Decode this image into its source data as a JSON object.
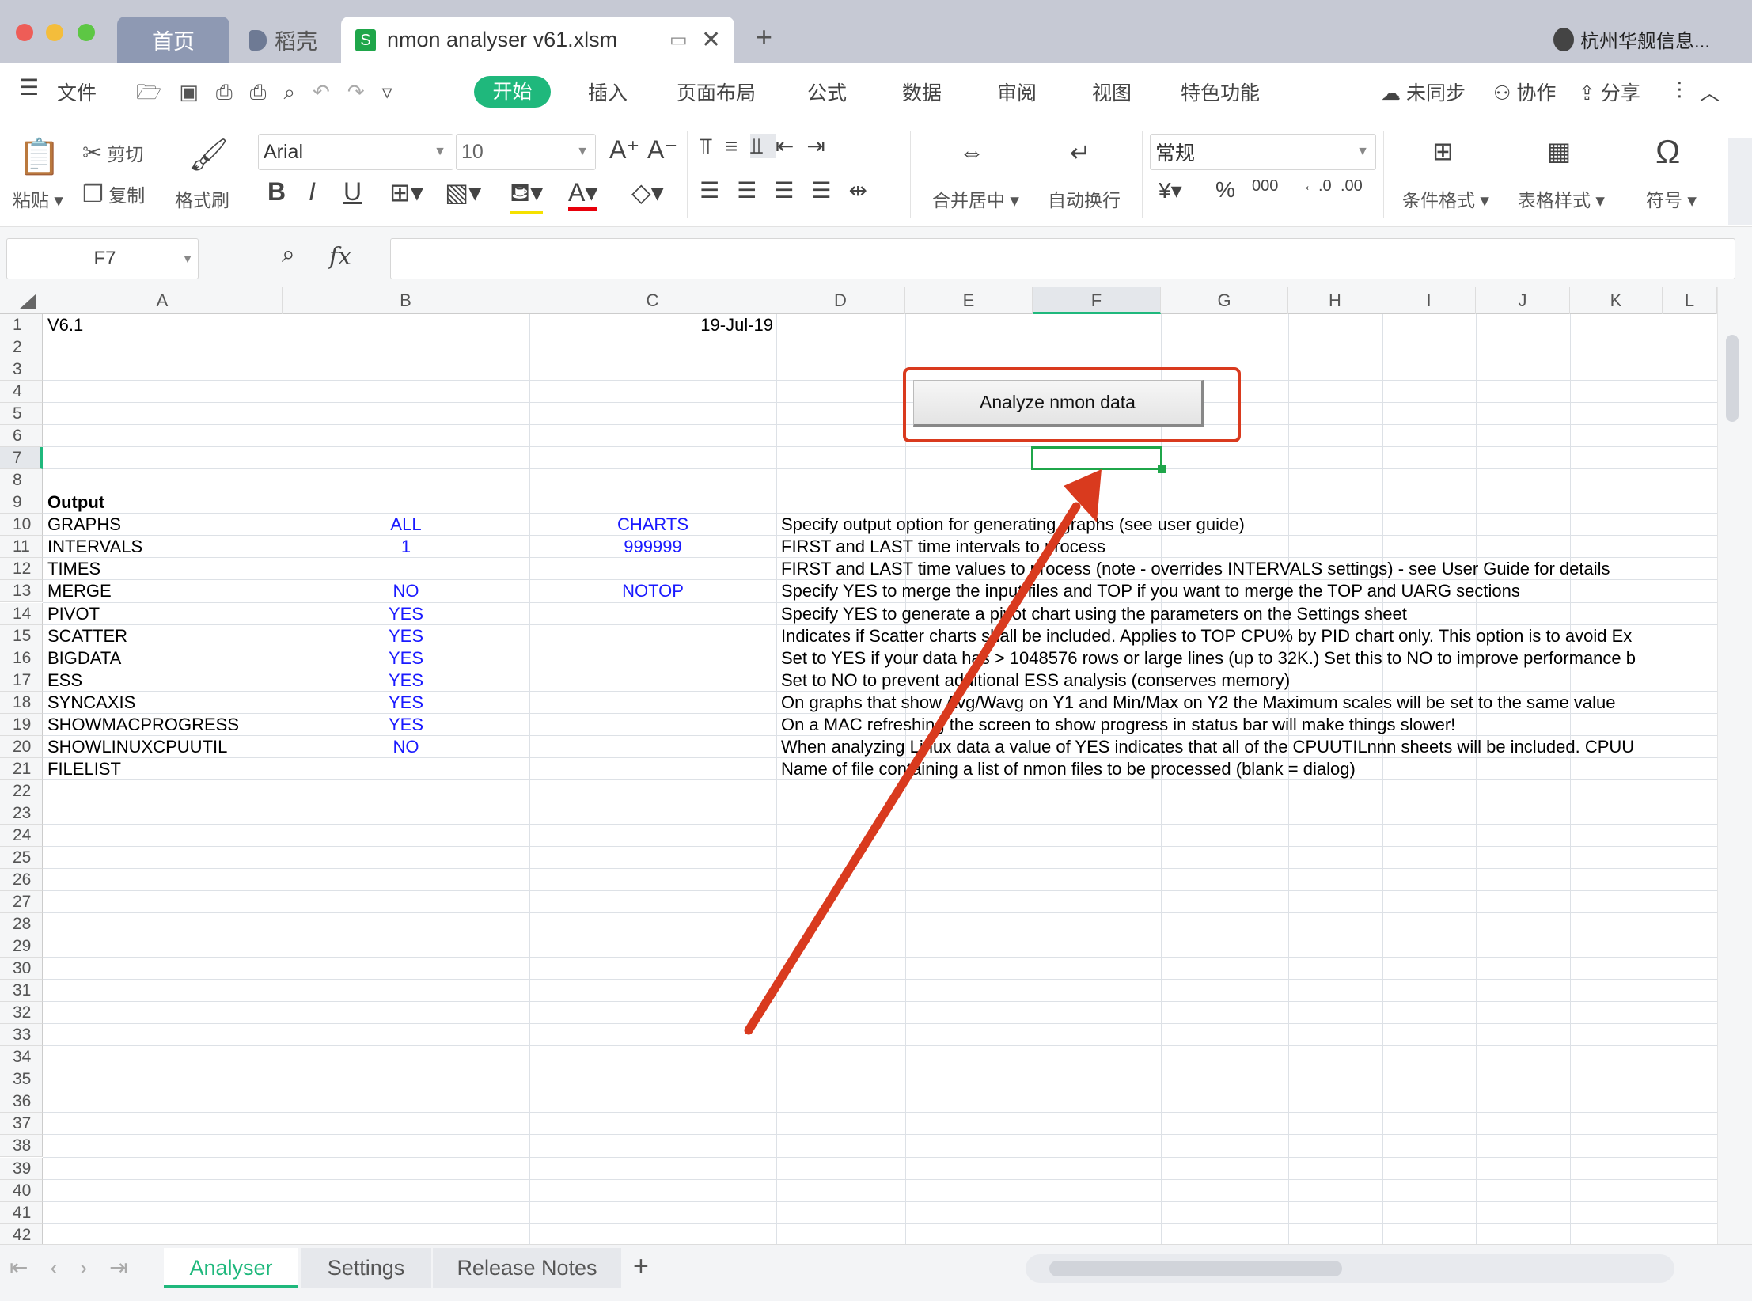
{
  "window": {
    "tabs": [
      {
        "label": "首页"
      },
      {
        "label": "稻壳"
      },
      {
        "label": "nmon analyser v61.xlsm"
      }
    ],
    "user": "杭州华舰信息..."
  },
  "menu": {
    "file": "文件",
    "items": [
      "开始",
      "插入",
      "页面布局",
      "公式",
      "数据",
      "审阅",
      "视图",
      "特色功能"
    ],
    "active": "开始",
    "sync": "未同步",
    "collab": "协作",
    "share": "分享"
  },
  "ribbon": {
    "paste": "粘贴",
    "cut": "剪切",
    "copy": "复制",
    "format_painter": "格式刷",
    "font": "Arial",
    "size": "10",
    "merge": "合并居中",
    "wrap": "自动换行",
    "number_format": "常规",
    "currency": "¥",
    "percent": "%",
    "thousands": "000",
    "cond_format": "条件格式",
    "table_style": "表格样式",
    "symbol": "符号"
  },
  "formula": {
    "cell_ref": "F7",
    "fx": "fx",
    "value": ""
  },
  "columns": [
    "A",
    "B",
    "C",
    "D",
    "E",
    "F",
    "G",
    "H",
    "I",
    "J",
    "K",
    "L"
  ],
  "selected_column": "F",
  "selected_cell": "F7",
  "macro_button": "Analyze nmon data",
  "accent": "#1fb87c",
  "annotation_color": "#d93a1e",
  "rows": [
    {
      "n": "1",
      "A": "V6.1",
      "C": "19-Jul-19"
    },
    {
      "n": "2"
    },
    {
      "n": "3"
    },
    {
      "n": "4"
    },
    {
      "n": "5"
    },
    {
      "n": "6"
    },
    {
      "n": "7"
    },
    {
      "n": "8"
    },
    {
      "n": "9",
      "A": "Output"
    },
    {
      "n": "10",
      "A": "GRAPHS",
      "B": "ALL",
      "C": "CHARTS",
      "D": "Specify output option for generating graphs (see user guide)"
    },
    {
      "n": "11",
      "A": "INTERVALS",
      "B": "1",
      "C": "999999",
      "D": "FIRST and LAST time intervals to process"
    },
    {
      "n": "12",
      "A": "TIMES",
      "D": "FIRST and LAST time values to process (note - overrides INTERVALS settings) - see User Guide for details"
    },
    {
      "n": "13",
      "A": "MERGE",
      "B": "NO",
      "C": "NOTOP",
      "D": "Specify YES to merge the input files and TOP if you want to merge the TOP and UARG sections"
    },
    {
      "n": "14",
      "A": "PIVOT",
      "B": "YES",
      "D": "Specify YES to generate a pivot chart using the parameters on the Settings sheet"
    },
    {
      "n": "15",
      "A": "SCATTER",
      "B": "YES",
      "D": "Indicates if Scatter charts shall be included.  Applies to TOP CPU% by PID chart only.  This option is to avoid Ex"
    },
    {
      "n": "16",
      "A": "BIGDATA",
      "B": "YES",
      "D": "Set to YES if your data has > 1048576 rows or large lines (up to 32K.)  Set this to NO to improve performance b"
    },
    {
      "n": "17",
      "A": "ESS",
      "B": "YES",
      "D": "Set to NO to prevent additional ESS analysis (conserves memory)"
    },
    {
      "n": "18",
      "A": "SYNCAXIS",
      "B": "YES",
      "D": "On graphs that show Avg/Wavg on Y1 and Min/Max on Y2 the Maximum scales will be set to the same value"
    },
    {
      "n": "19",
      "A": "SHOWMACPROGRESS",
      "B": "YES",
      "D": "On a MAC refreshing the screen to show progress in status bar will make things slower!"
    },
    {
      "n": "20",
      "A": "SHOWLINUXCPUUTIL",
      "B": "NO",
      "D": "When analyzing Linux data a value of YES indicates that all of the CPUUTILnnn sheets will be included.  CPUU"
    },
    {
      "n": "21",
      "A": "FILELIST",
      "D": "Name of file containing a list of nmon files to be processed (blank = dialog)"
    },
    {
      "n": "22"
    },
    {
      "n": "23"
    },
    {
      "n": "24"
    },
    {
      "n": "25"
    },
    {
      "n": "26"
    },
    {
      "n": "27"
    },
    {
      "n": "28"
    },
    {
      "n": "29"
    },
    {
      "n": "30"
    },
    {
      "n": "31"
    },
    {
      "n": "32"
    },
    {
      "n": "33"
    },
    {
      "n": "34"
    },
    {
      "n": "35"
    },
    {
      "n": "36"
    },
    {
      "n": "37"
    },
    {
      "n": "38"
    },
    {
      "n": "39"
    },
    {
      "n": "40"
    },
    {
      "n": "41"
    },
    {
      "n": "42"
    }
  ],
  "sheets": [
    {
      "label": "Analyser",
      "active": true
    },
    {
      "label": "Settings"
    },
    {
      "label": "Release Notes"
    }
  ],
  "add_sheet": "+"
}
